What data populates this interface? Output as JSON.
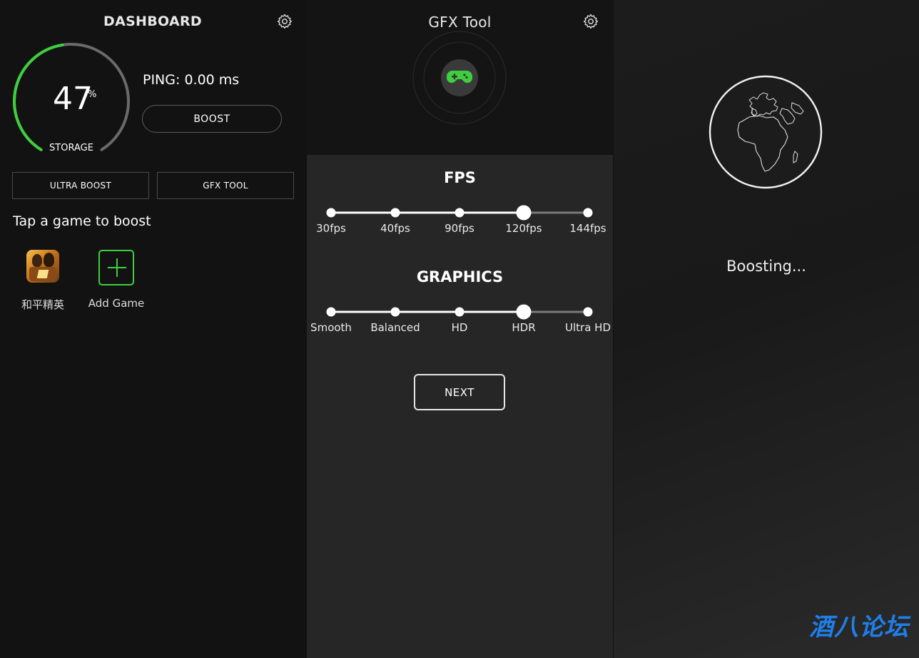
{
  "dashboard": {
    "title": "DASHBOARD",
    "storage": {
      "value": "47",
      "unit": "%",
      "label": "STORAGE",
      "percent": 47
    },
    "ping_text": "PING: 0.00 ms",
    "boost_label": "BOOST",
    "ultra_boost_label": "ULTRA BOOST",
    "gfx_tool_label": "GFX TOOL",
    "tap_text": "Tap a game to boost",
    "games": [
      {
        "name": "和平精英"
      }
    ],
    "add_game_label": "Add Game",
    "accent": "#3ecf3e"
  },
  "gfx": {
    "title": "GFX Tool",
    "fps_heading": "FPS",
    "fps_options": [
      "30fps",
      "40fps",
      "90fps",
      "120fps",
      "144fps"
    ],
    "fps_selected_index": 3,
    "graphics_heading": "GRAPHICS",
    "graphics_options": [
      "Smooth",
      "Balanced",
      "HD",
      "HDR",
      "Ultra HD"
    ],
    "graphics_selected_index": 3,
    "next_label": "NEXT"
  },
  "boosting": {
    "status_text": "Boosting..."
  },
  "watermark": "酒八论坛",
  "icons": {
    "settings": "gear-icon",
    "gamepad": "gamepad-icon",
    "add": "plus-icon",
    "globe": "globe-icon"
  }
}
